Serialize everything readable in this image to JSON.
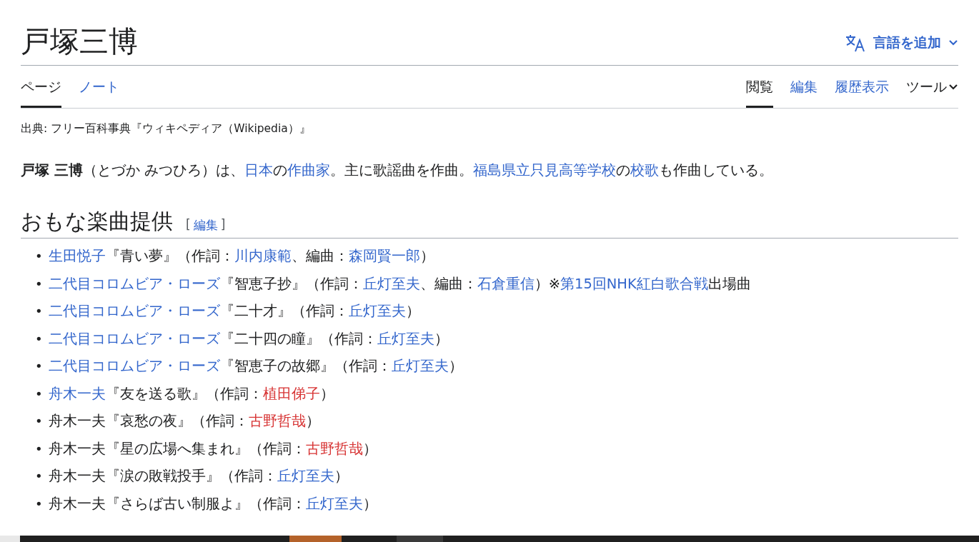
{
  "page": {
    "title": "戸塚三博",
    "language_button": "言語を追加"
  },
  "tabs_left": [
    {
      "label": "ページ",
      "selected": true
    },
    {
      "label": "ノート",
      "selected": false
    }
  ],
  "tabs_right": [
    {
      "label": "閲覧",
      "selected": true
    },
    {
      "label": "編集",
      "selected": false
    },
    {
      "label": "履歴表示",
      "selected": false
    }
  ],
  "tools_menu": "ツール",
  "source_note": "出典: フリー百科事典『ウィキペディア（Wikipedia）』",
  "intro": [
    {
      "text": "戸塚 三博",
      "kind": "bold"
    },
    {
      "text": "（とづか みつひろ）は、",
      "kind": "plain"
    },
    {
      "text": "日本",
      "kind": "link"
    },
    {
      "text": "の",
      "kind": "plain"
    },
    {
      "text": "作曲家",
      "kind": "link"
    },
    {
      "text": "。主に歌謡曲を作曲。",
      "kind": "plain"
    },
    {
      "text": "福島県立只見高等学校",
      "kind": "link"
    },
    {
      "text": "の",
      "kind": "plain"
    },
    {
      "text": "校歌",
      "kind": "link"
    },
    {
      "text": "も作曲している。",
      "kind": "plain"
    }
  ],
  "section": {
    "heading": "おもな楽曲提供",
    "edit_open": "[",
    "edit_link": "編集",
    "edit_close": "]",
    "items": [
      {
        "marker": "•",
        "parts": [
          {
            "text": "生田悦子",
            "kind": "link"
          },
          {
            "text": "『青い夢』（作詞：",
            "kind": "plain"
          },
          {
            "text": "川内康範",
            "kind": "link"
          },
          {
            "text": "、編曲：",
            "kind": "plain"
          },
          {
            "text": "森岡賢一郎",
            "kind": "link"
          },
          {
            "text": "）",
            "kind": "plain"
          }
        ]
      },
      {
        "marker": "•",
        "parts": [
          {
            "text": "二代目コロムビア・ローズ",
            "kind": "link"
          },
          {
            "text": "『智恵子抄』（作詞：",
            "kind": "plain"
          },
          {
            "text": "丘灯至夫",
            "kind": "link"
          },
          {
            "text": "、編曲：",
            "kind": "plain"
          },
          {
            "text": "石倉重信",
            "kind": "link"
          },
          {
            "text": "）※",
            "kind": "plain"
          },
          {
            "text": "第15回NHK紅白歌合戦",
            "kind": "link"
          },
          {
            "text": "出場曲",
            "kind": "plain"
          }
        ]
      },
      {
        "marker": "•",
        "parts": [
          {
            "text": "二代目コロムビア・ローズ",
            "kind": "link"
          },
          {
            "text": "『二十才』（作詞：",
            "kind": "plain"
          },
          {
            "text": "丘灯至夫",
            "kind": "link"
          },
          {
            "text": "）",
            "kind": "plain"
          }
        ]
      },
      {
        "marker": "•",
        "parts": [
          {
            "text": "二代目コロムビア・ローズ",
            "kind": "link"
          },
          {
            "text": "『二十四の瞳』（作詞：",
            "kind": "plain"
          },
          {
            "text": "丘灯至夫",
            "kind": "link"
          },
          {
            "text": "）",
            "kind": "plain"
          }
        ]
      },
      {
        "marker": "•",
        "parts": [
          {
            "text": "二代目コロムビア・ローズ",
            "kind": "link"
          },
          {
            "text": "『智恵子の故郷』（作詞：",
            "kind": "plain"
          },
          {
            "text": "丘灯至夫",
            "kind": "link"
          },
          {
            "text": "）",
            "kind": "plain"
          }
        ]
      },
      {
        "marker": "•",
        "parts": [
          {
            "text": "舟木一夫",
            "kind": "link"
          },
          {
            "text": "『友を送る歌』（作詞：",
            "kind": "plain"
          },
          {
            "text": "植田俤子",
            "kind": "redlink"
          },
          {
            "text": "）",
            "kind": "plain"
          }
        ]
      },
      {
        "marker": "•",
        "parts": [
          {
            "text": "舟木一夫『哀愁の夜』（作詞：",
            "kind": "plain"
          },
          {
            "text": "古野哲哉",
            "kind": "redlink"
          },
          {
            "text": "）",
            "kind": "plain"
          }
        ]
      },
      {
        "marker": "•",
        "parts": [
          {
            "text": "舟木一夫『星の広場へ集まれ』（作詞：",
            "kind": "plain"
          },
          {
            "text": "古野哲哉",
            "kind": "redlink"
          },
          {
            "text": "）",
            "kind": "plain"
          }
        ]
      },
      {
        "marker": "•",
        "parts": [
          {
            "text": "舟木一夫『涙の敗戦投手』（作詞：",
            "kind": "plain"
          },
          {
            "text": "丘灯至夫",
            "kind": "link"
          },
          {
            "text": "）",
            "kind": "plain"
          }
        ]
      },
      {
        "marker": "•",
        "parts": [
          {
            "text": "舟木一夫『さらば古い制服よ』（作詞：",
            "kind": "plain"
          },
          {
            "text": "丘灯至夫",
            "kind": "link"
          },
          {
            "text": "）",
            "kind": "plain"
          }
        ]
      }
    ]
  }
}
